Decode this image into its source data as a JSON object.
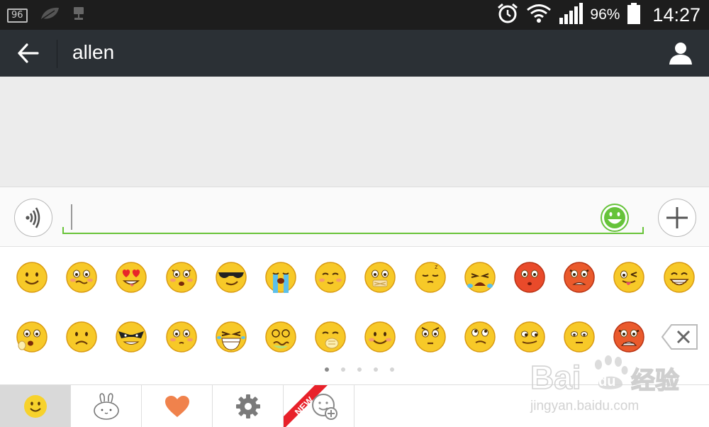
{
  "status_bar": {
    "badge_value": "96",
    "battery_percent": "96%",
    "time": "14:27",
    "icons": [
      "notification-badge-icon",
      "leaf-icon",
      "usb-debug-icon",
      "alarm-clock-icon",
      "wifi-icon",
      "signal-icon",
      "battery-icon"
    ]
  },
  "header": {
    "title": "allen",
    "back_icon": "back-arrow-icon",
    "profile_icon": "person-icon",
    "background": "#2b3035"
  },
  "input_bar": {
    "text_value": "",
    "accent_color": "#68c338",
    "voice_icon": "voice-icon",
    "emoji_icon": "smiley-icon",
    "more_icon": "plus-icon"
  },
  "emoji_panel": {
    "rows": [
      [
        "smile",
        "blush-wobble",
        "heart-eyes",
        "shocked",
        "cool-sunglasses",
        "crying-tears",
        "shy-blush",
        "zipped-mouth",
        "sleepy",
        "big-cry",
        "embarrassed-red",
        "angry-red",
        "tongue-wink",
        "big-grin"
      ],
      [
        "surprised-hand",
        "sad",
        "villain-mask",
        "blushing-eyes",
        "laughing-tears",
        "sick-dizzy",
        "sneaky-hand",
        "gentle-smile",
        "startled",
        "thinking",
        "smug",
        "doubtful",
        "furious"
      ]
    ],
    "delete_icon": "backspace-icon",
    "page_count": 5,
    "current_page": 1
  },
  "tab_bar": {
    "tabs": [
      {
        "name": "emoji",
        "icon": "smiley-face-icon",
        "active": true
      },
      {
        "name": "rabbit",
        "icon": "rabbit-icon",
        "active": false
      },
      {
        "name": "favorites",
        "icon": "heart-icon",
        "active": false
      },
      {
        "name": "settings",
        "icon": "gear-icon",
        "active": false
      },
      {
        "name": "add",
        "icon": "add-sticker-icon",
        "badge": "NEW",
        "active": false
      }
    ]
  },
  "watermark": {
    "logo": "Bai du 经验",
    "url": "jingyan.baidu.com"
  }
}
